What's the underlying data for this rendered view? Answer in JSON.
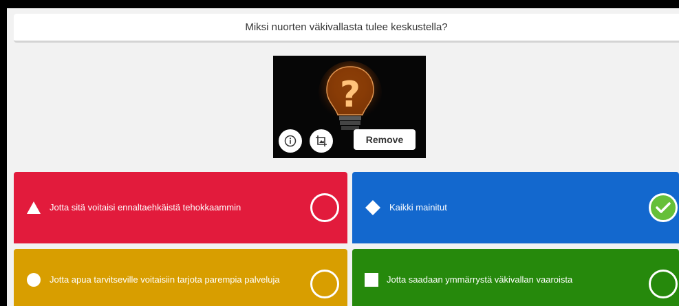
{
  "question": "Miksi nuorten väkivallasta tulee keskustella?",
  "media": {
    "image_description_icon": "question-mark-lightbulb",
    "remove_label": "Remove"
  },
  "answers": [
    {
      "text": "Jotta sitä voitaisi ennaltaehkäistä tehokkaammin",
      "shape": "triangle",
      "color": "#e21b3c",
      "correct": false
    },
    {
      "text": "Kaikki mainitut",
      "shape": "diamond",
      "color": "#1368ce",
      "correct": true
    },
    {
      "text": "Jotta apua tarvitseville voitaisiin tarjota parempia palveluja",
      "shape": "circle",
      "color": "#d89e00",
      "correct": false
    },
    {
      "text": "Jotta saadaan ymmärrystä väkivallan vaaroista",
      "shape": "square",
      "color": "#26890c",
      "correct": false
    }
  ]
}
